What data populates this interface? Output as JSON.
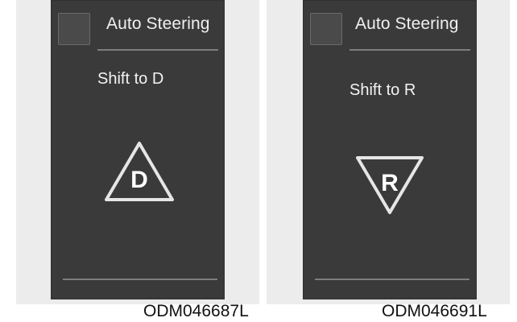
{
  "panels": [
    {
      "checkbox_label": "Auto Steering",
      "message": "Shift to D",
      "gear_letter": "D",
      "icon": "triangle-up-warning-icon",
      "caption": "ODM046687L"
    },
    {
      "checkbox_label": "Auto Steering",
      "message": "Shift to R",
      "gear_letter": "R",
      "icon": "triangle-down-warning-icon",
      "caption": "ODM046691L"
    }
  ],
  "colors": {
    "screen_bg": "#3a3a3a",
    "text": "#f0f0f0",
    "rule": "#8a8a8a",
    "outer_bg": "#ececec"
  }
}
